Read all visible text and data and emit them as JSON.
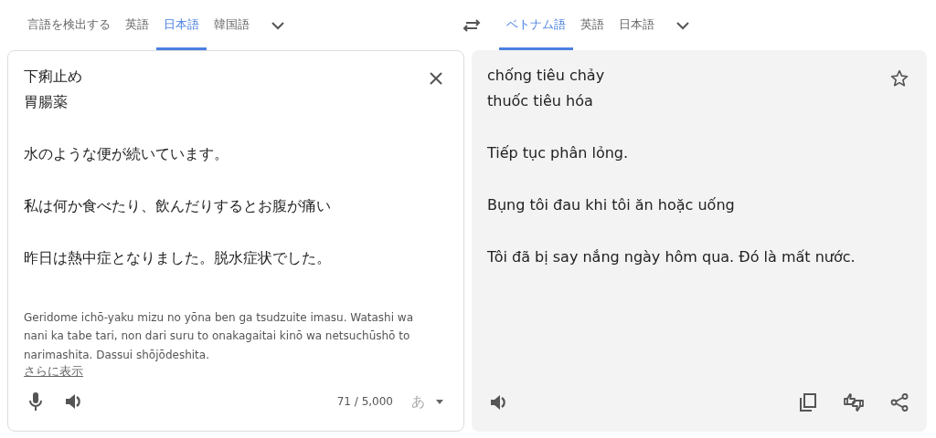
{
  "source_languages": [
    {
      "label": "言語を検出する",
      "selected": false
    },
    {
      "label": "英語",
      "selected": false
    },
    {
      "label": "日本語",
      "selected": true
    },
    {
      "label": "韓国語",
      "selected": false
    }
  ],
  "target_languages": [
    {
      "label": "ベトナム語",
      "selected": true
    },
    {
      "label": "英語",
      "selected": false
    },
    {
      "label": "日本語",
      "selected": false
    }
  ],
  "source": {
    "paragraphs": [
      {
        "lines": [
          "下痢止め",
          "胃腸薬"
        ]
      },
      {
        "lines": [
          "水のような便が続いています。"
        ]
      },
      {
        "lines": [
          "私は何か食べたり、飲んだりするとお腹が痛い"
        ]
      },
      {
        "lines": [
          "昨日は熱中症となりました。脱水症状でした。"
        ]
      }
    ],
    "romanization": "Geridome ichō-yaku mizu no yōna ben ga tsudzuite imasu. Watashi wa nani ka tabe tari, non dari suru to onakagaitai kinō wa netsuchūshō to narimashita. Dassui shōjōdeshita.",
    "show_more": "さらに表示",
    "char_count": "71 / 5,000",
    "input_method": "あ"
  },
  "translation": {
    "paragraphs": [
      {
        "lines": [
          "chống tiêu chảy",
          "thuốc tiêu hóa"
        ]
      },
      {
        "lines": [
          "Tiếp tục phân lỏng."
        ]
      },
      {
        "lines": [
          "Bụng tôi đau khi tôi ăn hoặc uống"
        ]
      },
      {
        "lines": [
          "Tôi đã bị say nắng ngày hôm qua. Đó là mất nước."
        ]
      }
    ]
  }
}
